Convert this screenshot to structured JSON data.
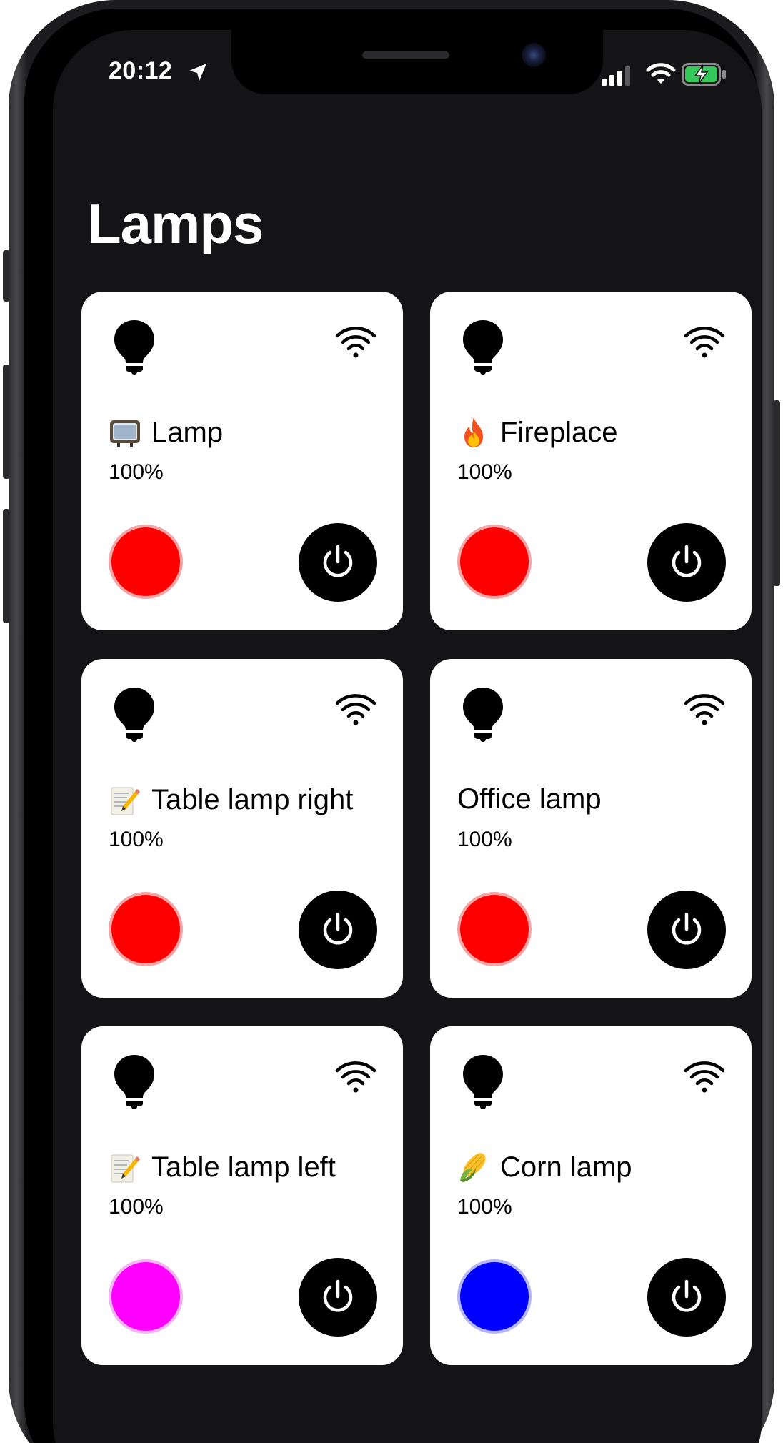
{
  "status_bar": {
    "time": "20:12"
  },
  "page": {
    "title": "Lamps"
  },
  "colors": {
    "screen_background": "#141416",
    "card_background": "#ffffff",
    "power_button": "#000000"
  },
  "lamps": [
    {
      "emoji_icon": "television-icon",
      "name": "Lamp",
      "level": "100%",
      "color": "#ff0000",
      "ring": "#f5a5a5"
    },
    {
      "emoji_icon": "fire-icon",
      "name": "Fireplace",
      "level": "100%",
      "color": "#ff0000",
      "ring": "#f5a5a5"
    },
    {
      "emoji_icon": "memo-icon",
      "name": "Table lamp right",
      "level": "100%",
      "color": "#ff0000",
      "ring": "#f5a5a5"
    },
    {
      "emoji_icon": "",
      "name": "Office lamp",
      "level": "100%",
      "color": "#ff0000",
      "ring": "#f5a5a5"
    },
    {
      "emoji_icon": "memo-icon",
      "name": "Table lamp left",
      "level": "100%",
      "color": "#ff00ff",
      "ring": "#f5b5f5"
    },
    {
      "emoji_icon": "corn-icon",
      "name": "Corn lamp",
      "level": "100%",
      "color": "#0000ff",
      "ring": "#b5b5f5"
    }
  ]
}
